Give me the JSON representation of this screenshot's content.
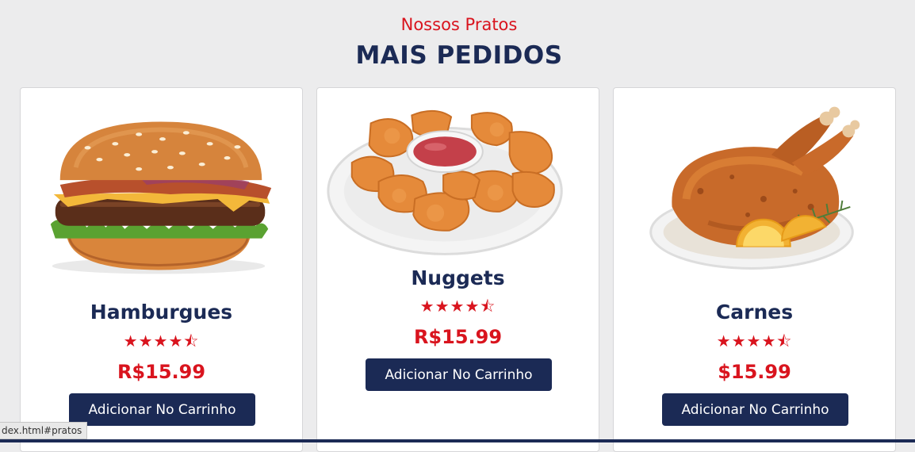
{
  "section": {
    "subtitle": "Nossos Pratos",
    "title": "MAIS PEDIDOS"
  },
  "dishes": [
    {
      "name": "Hamburgues",
      "rating_text": "4.5 stars",
      "rating": 4.5,
      "price": "R$15.99",
      "button": "Adicionar No Carrinho",
      "image_icon": "hamburger-image"
    },
    {
      "name": "Nuggets",
      "rating_text": "4.5 stars",
      "rating": 4.5,
      "price": "R$15.99",
      "button": "Adicionar No Carrinho",
      "image_icon": "nuggets-image"
    },
    {
      "name": "Carnes",
      "rating_text": "4.5 stars",
      "rating": 4.5,
      "price": "$15.99",
      "button": "Adicionar No Carrinho",
      "image_icon": "roast-chicken-image"
    }
  ],
  "status_bar": {
    "url": "dex.html#pratos"
  },
  "colors": {
    "accent": "#d9141e",
    "navy": "#1b2a55",
    "background": "#ececed"
  }
}
